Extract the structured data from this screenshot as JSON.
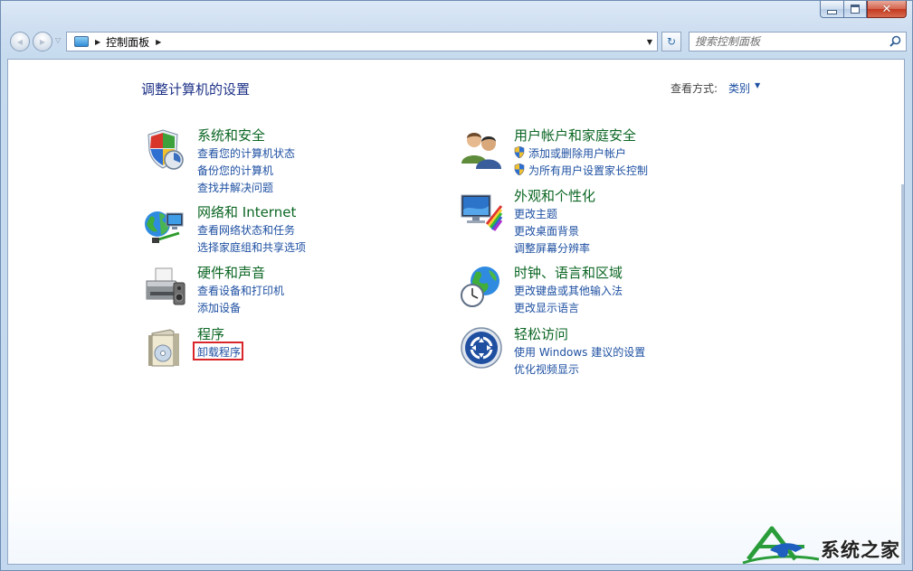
{
  "window": {
    "caption_buttons": {
      "min_icon": "minimize-icon",
      "max_icon": "maximize-icon",
      "close_icon": "close-icon",
      "close_glyph": "✕"
    }
  },
  "navbar": {
    "back_glyph": "◀",
    "forward_glyph": "▶",
    "address": {
      "icon": "control-panel-icon",
      "path": "控制面板"
    },
    "refresh_glyph": "↻",
    "search": {
      "placeholder": "搜索控制面板",
      "icon": "search-icon"
    }
  },
  "main": {
    "title": "调整计算机的设置",
    "view_by_label": "查看方式:",
    "view_by_value": "类别",
    "categories": [
      {
        "icon": "shield-icon",
        "title": "系统和安全",
        "links": [
          "查看您的计算机状态",
          "备份您的计算机",
          "查找并解决问题"
        ]
      },
      {
        "icon": "network-icon",
        "title": "网络和 Internet",
        "links": [
          "查看网络状态和任务",
          "选择家庭组和共享选项"
        ]
      },
      {
        "icon": "printer-icon",
        "title": "硬件和声音",
        "links": [
          "查看设备和打印机",
          "添加设备"
        ]
      },
      {
        "icon": "programs-icon",
        "title": "程序",
        "links": [
          "卸载程序"
        ]
      },
      {
        "icon": "users-icon",
        "title": "用户帐户和家庭安全",
        "links": [
          "添加或删除用户帐户",
          "为所有用户设置家长控制"
        ]
      },
      {
        "icon": "monitor-icon",
        "title": "外观和个性化",
        "links": [
          "更改主题",
          "更改桌面背景",
          "调整屏幕分辨率"
        ]
      },
      {
        "icon": "clock-globe-icon",
        "title": "时钟、语言和区域",
        "links": [
          "更改键盘或其他输入法",
          "更改显示语言"
        ]
      },
      {
        "icon": "ease-of-access-icon",
        "title": "轻松访问",
        "links": [
          "使用 Windows 建议的设置",
          "优化视频显示"
        ]
      }
    ]
  },
  "watermark": {
    "text": "系统之家",
    "icon": "house-logo-icon"
  },
  "colors": {
    "title_green": "#0b6623",
    "link_blue": "#1e50a2",
    "heading_blue": "#1e3287",
    "highlight_red": "#d8262a"
  }
}
